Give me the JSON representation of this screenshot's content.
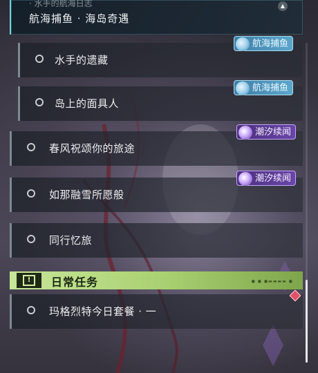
{
  "top_card": {
    "subtitle": "· 水手的航海日志",
    "title": "航海捕鱼 · 海岛奇遇"
  },
  "quests": [
    {
      "label": "水手的遗藏",
      "tag": "航海捕鱼"
    },
    {
      "label": "岛上的面具人",
      "tag": "航海捕鱼"
    },
    {
      "label": "春风祝颂你的旅途",
      "tag": "潮汐续闻"
    },
    {
      "label": "如那融雪所愿般",
      "tag": "潮汐续闻"
    },
    {
      "label": "同行忆旅",
      "tag": ""
    }
  ],
  "daily": {
    "title": "日常任务",
    "decoration": "● ● ●▬▬▬▬ ●",
    "quests": [
      {
        "label": "玛格烈特今日套餐 · 一"
      }
    ]
  },
  "colors": {
    "fish_tag": "#5ca6cc",
    "tide_tag": "#6a46a8",
    "daily_header": "#a7cf6f",
    "accent_line": "#6fd3e0"
  }
}
